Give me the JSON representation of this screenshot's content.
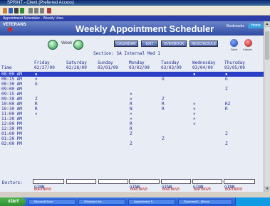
{
  "window": {
    "title": "SPRINT - Client (Preferred Access)"
  },
  "app_bar": {
    "title": "Appointment Scheduler - Weekly View"
  },
  "header": {
    "logo_text": "VETERANS",
    "title": "Weekly Appointment Scheduler",
    "bookmarks": "Bookmarks",
    "home": "Home"
  },
  "week_nav": {
    "label": "Week"
  },
  "buttons": {
    "calendar": "CALENDAR",
    "exit": "EXIT",
    "overbook": "OVERBOOK",
    "reschedule": "RESCHEDULE",
    "save": "Save",
    "cancel": "Cancel"
  },
  "section": "Section: SA Internal Med 1",
  "time_header": "Time",
  "days": [
    {
      "day": "Friday",
      "date": "02/27/09"
    },
    {
      "day": "Saturday",
      "date": "02/28/09"
    },
    {
      "day": "Sunday",
      "date": "03/01/09"
    },
    {
      "day": "Monday",
      "date": "03/02/09"
    },
    {
      "day": "Tuesday",
      "date": "03/03/09"
    },
    {
      "day": "Wednesday",
      "date": "03/04/09"
    },
    {
      "day": "Thursday",
      "date": "03/05/09"
    }
  ],
  "rows": [
    {
      "time": "08:00 AM",
      "cells": [
        "▪",
        "",
        "",
        "",
        "",
        "▪",
        "▪"
      ]
    },
    {
      "time": "08:15 AM",
      "cells": [
        "×",
        "",
        "",
        "",
        "G",
        "",
        "G"
      ]
    },
    {
      "time": "08:30 AM",
      "cells": [
        "G",
        "",
        "",
        "",
        "",
        "",
        ""
      ]
    },
    {
      "time": "09:00 AM",
      "cells": [
        "",
        "",
        "",
        "",
        "",
        "",
        "Z"
      ]
    },
    {
      "time": "09:15 AM",
      "cells": [
        "",
        "",
        "",
        "×",
        "",
        "",
        ""
      ]
    },
    {
      "time": "09:30 AM",
      "cells": [
        "Z",
        "",
        "",
        "×",
        "Z",
        "",
        ""
      ]
    },
    {
      "time": "10:00 AM",
      "cells": [
        "R",
        "",
        "",
        "R",
        "R",
        "×",
        "RZ"
      ]
    },
    {
      "time": "10:30 AM",
      "cells": [
        "R",
        "",
        "",
        "N",
        "R",
        "×",
        "R"
      ]
    },
    {
      "time": "11:00 AM",
      "cells": [
        "×",
        "",
        "",
        "×",
        "",
        "×",
        ""
      ]
    },
    {
      "time": "11:30 AM",
      "cells": [
        "",
        "",
        "",
        "×",
        "",
        "×",
        ""
      ]
    },
    {
      "time": "12:00 PM",
      "cells": [
        "",
        "",
        "",
        "R",
        "",
        "×",
        ""
      ]
    },
    {
      "time": "12:30 PM",
      "cells": [
        "",
        "",
        "",
        "R",
        "",
        "",
        ""
      ]
    },
    {
      "time": "01:00 PM",
      "cells": [
        "",
        "",
        "",
        "Z",
        "",
        "",
        "Z"
      ]
    },
    {
      "time": "01:30 PM",
      "cells": [
        "",
        "",
        "",
        "",
        "Z",
        "",
        ""
      ]
    },
    {
      "time": "02:00 PM",
      "cells": [
        "",
        "",
        "",
        "Z",
        "",
        "",
        "Z"
      ]
    }
  ],
  "doctors": {
    "label": "Doctors:",
    "fields": [
      {
        "value": "BORTNOVE",
        "name": "GINN"
      },
      {
        "value": "",
        "name": ""
      },
      {
        "value": "",
        "name": ""
      },
      {
        "value": "BORTNOVE",
        "name": "GINN"
      },
      {
        "value": "BORTNOVE",
        "name": "GINN"
      },
      {
        "value": "BORTNOVE",
        "name": "GINN"
      },
      {
        "value": "BORTNOVE",
        "name": "GINN"
      }
    ]
  },
  "taskbar": {
    "start": "start",
    "tasks": [
      "Microsoft Exce",
      "Windows Live...",
      "Appointment S...",
      "Document1 - Micros..."
    ]
  },
  "colors": {
    "selection": "#2a3ec8",
    "text": "#1c2a8c",
    "header": "#2f4aa5"
  }
}
